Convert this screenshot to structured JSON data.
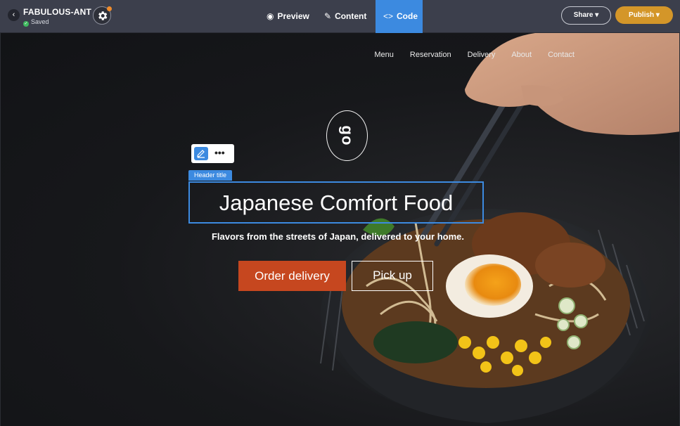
{
  "editor": {
    "back_icon": "‹",
    "site_name": "FABULOUS-ANT",
    "save_status": "Saved",
    "settings_icon": "gear-icon",
    "tabs": [
      {
        "label": "Preview",
        "icon": "eye-icon"
      },
      {
        "label": "Content",
        "icon": "pencil-icon"
      },
      {
        "label": "Code",
        "icon": "code-icon",
        "active": true
      }
    ],
    "share_label": "Share ▾",
    "publish_label": "Publish ▾",
    "colors": {
      "active_tab": "#3c8ae0",
      "publish": "#d49629"
    }
  },
  "site": {
    "nav": [
      "Menu",
      "Reservation",
      "Delivery",
      "About",
      "Contact"
    ],
    "logo_text": "go",
    "selection_label": "Header title",
    "header_title": "Japanese Comfort Food",
    "subtitle": "Flavors from the streets of Japan, delivered to your home.",
    "primary_cta": "Order delivery",
    "secondary_cta": "Pick up",
    "colors": {
      "primary_cta": "#c6471f"
    }
  }
}
